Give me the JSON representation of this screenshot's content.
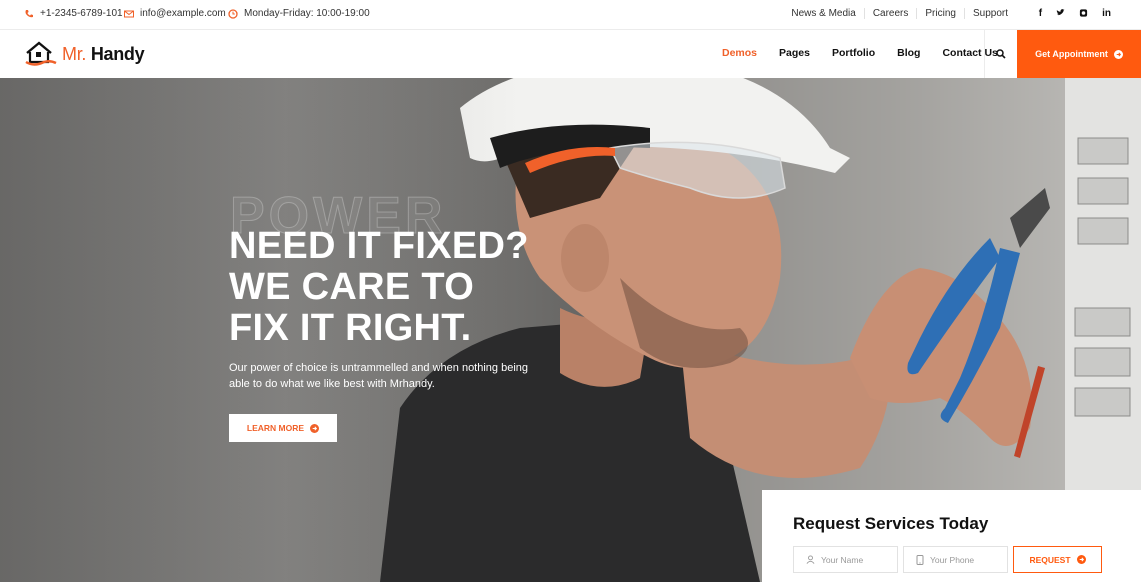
{
  "colors": {
    "accent": "#ff5a0f",
    "text": "#111111"
  },
  "topbar": {
    "phone": "+1-2345-6789-101",
    "email": "info@example.com",
    "hours": "Monday-Friday: 10:00-19:00",
    "links": [
      "News & Media",
      "Careers",
      "Pricing",
      "Support"
    ],
    "social": [
      "f",
      "t",
      "ig",
      "in"
    ]
  },
  "logo": {
    "mr": "Mr.",
    "name": "Handy"
  },
  "nav": {
    "items": [
      "Demos",
      "Pages",
      "Portfolio",
      "Blog",
      "Contact Us"
    ],
    "active": "Demos"
  },
  "cta": {
    "label": "Get Appointment"
  },
  "hero": {
    "watermark": "POWER",
    "headline": [
      "NEED IT FIXED?",
      "WE CARE TO",
      "FIX IT RIGHT."
    ],
    "subtext": "Our power of choice is untrammelled and when nothing being able to do what we like best with Mrhandy.",
    "button": "LEARN MORE"
  },
  "request": {
    "title": "Request Services Today",
    "name_placeholder": "Your Name",
    "phone_placeholder": "Your Phone",
    "button": "REQUEST"
  }
}
